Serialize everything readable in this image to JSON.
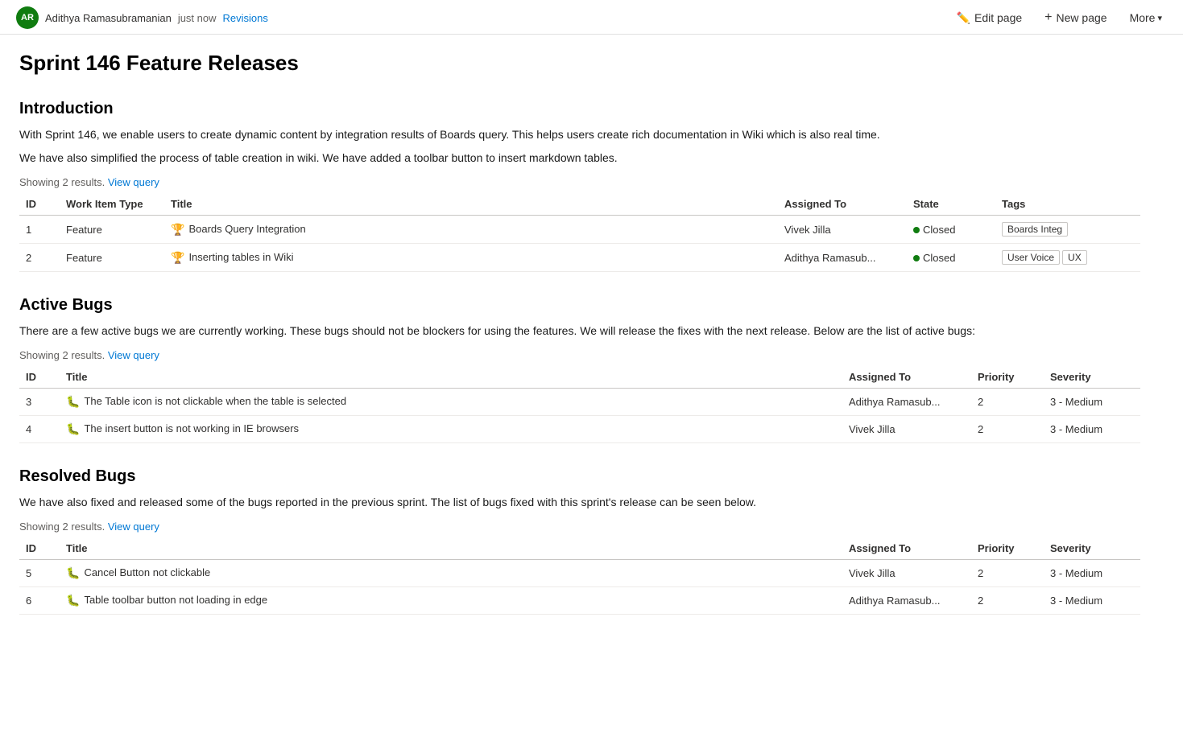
{
  "page": {
    "title": "Sprint 146 Feature Releases"
  },
  "header": {
    "avatar_initials": "AR",
    "author_name": "Adithya Ramasubramanian",
    "timestamp": "just now",
    "revisions_label": "Revisions",
    "edit_page_label": "Edit page",
    "new_page_label": "New page",
    "more_label": "More"
  },
  "sections": [
    {
      "id": "introduction",
      "title": "Introduction",
      "paragraphs": [
        "With Sprint 146, we enable users to create dynamic content by integration results of Boards query. This helps users create rich documentation in Wiki which is also real time.",
        "We have also simplified the process of table creation in wiki. We have added a toolbar button to insert markdown tables."
      ],
      "showing_text": "Showing 2 results.",
      "view_query_label": "View query",
      "table_type": "features",
      "columns": [
        "ID",
        "Work Item Type",
        "Title",
        "Assigned To",
        "State",
        "Tags"
      ],
      "rows": [
        {
          "id": "1",
          "work_item_type": "Feature",
          "title": "Boards Query Integration",
          "assigned_to": "Vivek Jilla",
          "state": "Closed",
          "tags": [
            "Boards Integ"
          ]
        },
        {
          "id": "2",
          "work_item_type": "Feature",
          "title": "Inserting tables in Wiki",
          "assigned_to": "Adithya Ramasub...",
          "state": "Closed",
          "tags": [
            "User Voice",
            "UX"
          ]
        }
      ]
    },
    {
      "id": "active-bugs",
      "title": "Active Bugs",
      "paragraphs": [
        "There are a few active bugs we are currently working. These bugs should not be blockers for using the features. We will release the fixes with the next release. Below are the list of active bugs:"
      ],
      "showing_text": "Showing 2 results.",
      "view_query_label": "View query",
      "table_type": "bugs",
      "columns": [
        "ID",
        "Title",
        "Assigned To",
        "Priority",
        "Severity"
      ],
      "rows": [
        {
          "id": "3",
          "title": "The Table icon is not clickable when the table is selected",
          "assigned_to": "Adithya Ramasub...",
          "priority": "2",
          "severity": "3 - Medium"
        },
        {
          "id": "4",
          "title": "The insert button is not working in IE browsers",
          "assigned_to": "Vivek Jilla",
          "priority": "2",
          "severity": "3 - Medium"
        }
      ]
    },
    {
      "id": "resolved-bugs",
      "title": "Resolved Bugs",
      "paragraphs": [
        "We have also fixed and released some of the bugs reported in the previous sprint. The list of bugs fixed with this sprint's release can be seen below."
      ],
      "showing_text": "Showing 2 results.",
      "view_query_label": "View query",
      "table_type": "bugs",
      "columns": [
        "ID",
        "Title",
        "Assigned To",
        "Priority",
        "Severity"
      ],
      "rows": [
        {
          "id": "5",
          "title": "Cancel Button not clickable",
          "assigned_to": "Vivek Jilla",
          "priority": "2",
          "severity": "3 - Medium"
        },
        {
          "id": "6",
          "title": "Table toolbar button not loading in edge",
          "assigned_to": "Adithya Ramasub...",
          "priority": "2",
          "severity": "3 - Medium"
        }
      ]
    }
  ]
}
